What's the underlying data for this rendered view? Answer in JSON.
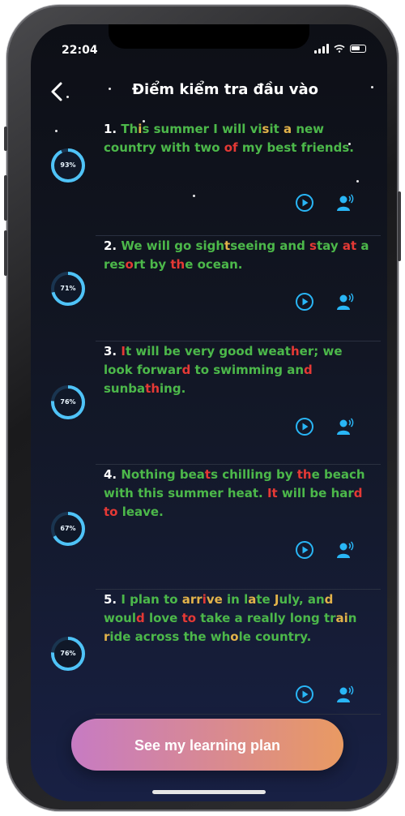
{
  "status_bar": {
    "time": "22:04"
  },
  "header": {
    "title": "Điểm kiểm tra đầu vào"
  },
  "colors": {
    "correct": "#4cb84a",
    "incorrect": "#e53935",
    "partial": "#e2b24a",
    "accent": "#29b6f6"
  },
  "items": [
    {
      "score": "93%",
      "number": "1."
    },
    {
      "score": "71%",
      "number": "2."
    },
    {
      "score": "76%",
      "number": "3."
    },
    {
      "score": "67%",
      "number": "4."
    },
    {
      "score": "76%",
      "number": "5."
    }
  ],
  "sentences": {
    "s1": [
      "Th",
      "i",
      "s summer I will vi",
      "s",
      "it ",
      "a",
      " new country with two ",
      "of",
      " my best friends."
    ],
    "s2": [
      "We will go sigh",
      "t",
      "seeing and ",
      "s",
      "tay ",
      "at",
      " a res",
      "o",
      "rt by ",
      "th",
      "e ocean."
    ],
    "s3": [
      "I",
      "t",
      " will be very good weat",
      "h",
      "er; we look forwar",
      "d",
      " to swimming an",
      "d",
      " sunba",
      "th",
      "ing."
    ],
    "s4": [
      "Nothing bea",
      "t",
      "s chilling by ",
      "th",
      "e beach with this summer heat. ",
      "It",
      " will be har",
      "d",
      " ",
      "to",
      " leave."
    ],
    "s5": [
      "I plan to ",
      "arr",
      "i",
      "ve",
      " in l",
      "a",
      "te ",
      "J",
      "uly, an",
      "d",
      " woul",
      "d",
      " love ",
      "to",
      " take a really long tr",
      "ai",
      "n ",
      "r",
      "ide across the wh",
      "o",
      "le country."
    ]
  },
  "cta": {
    "label": "See my learning plan"
  },
  "icons": {
    "back": "back-arrow-icon",
    "play": "play-circle-icon",
    "speak": "user-speaking-icon"
  }
}
